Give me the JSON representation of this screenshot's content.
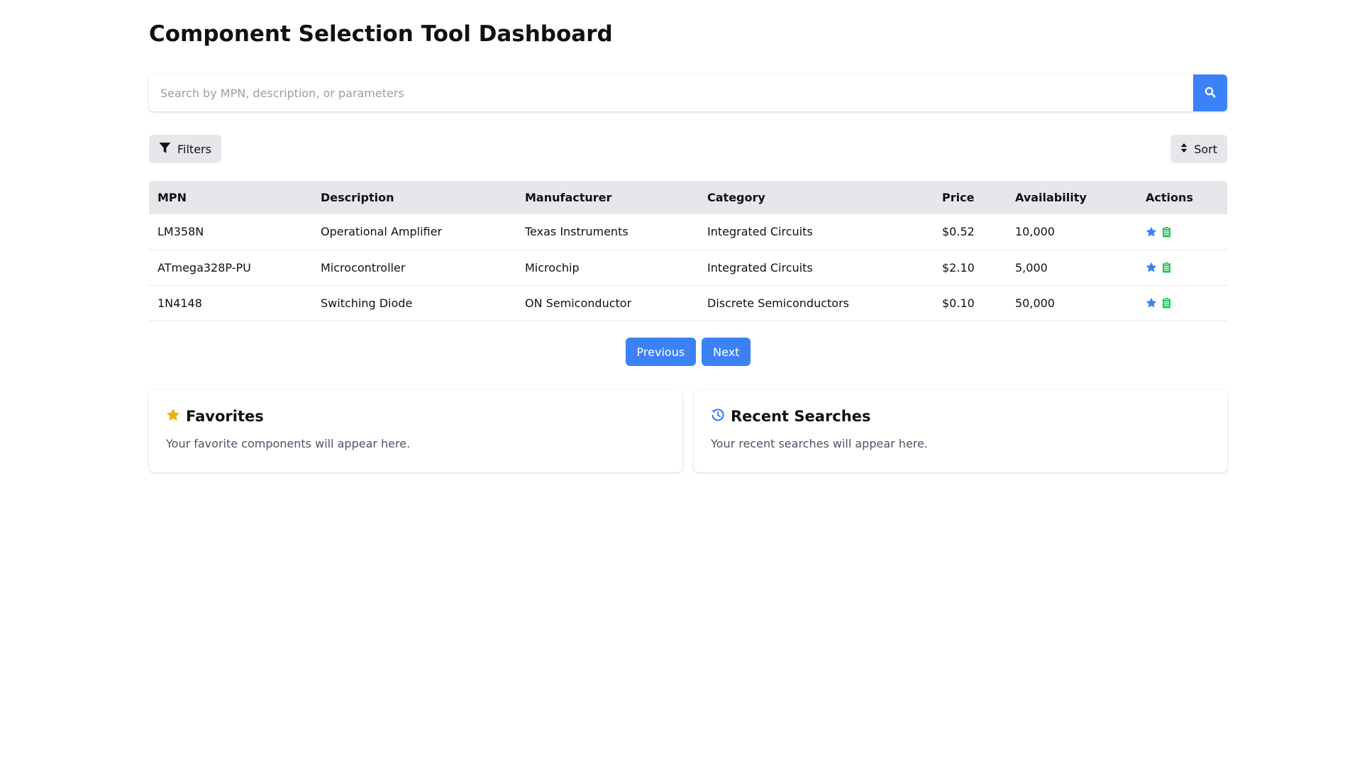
{
  "page": {
    "title": "Component Selection Tool Dashboard"
  },
  "search": {
    "placeholder": "Search by MPN, description, or parameters",
    "value": "",
    "button_icon": "search-icon"
  },
  "toolbar": {
    "filters_label": "Filters",
    "filters_icon": "filter-icon",
    "sort_label": "Sort",
    "sort_icon": "sort-icon"
  },
  "table": {
    "headers": [
      "MPN",
      "Description",
      "Manufacturer",
      "Category",
      "Price",
      "Availability",
      "Actions"
    ],
    "rows": [
      {
        "mpn": "LM358N",
        "description": "Operational Amplifier",
        "manufacturer": "Texas Instruments",
        "category": "Integrated Circuits",
        "price": "$0.52",
        "availability": "10,000"
      },
      {
        "mpn": "ATmega328P-PU",
        "description": "Microcontroller",
        "manufacturer": "Microchip",
        "category": "Integrated Circuits",
        "price": "$2.10",
        "availability": "5,000"
      },
      {
        "mpn": "1N4148",
        "description": "Switching Diode",
        "manufacturer": "ON Semiconductor",
        "category": "Discrete Semiconductors",
        "price": "$0.10",
        "availability": "50,000"
      }
    ],
    "action_icons": [
      "star-icon",
      "clipboard-icon"
    ]
  },
  "pagination": {
    "previous_label": "Previous",
    "next_label": "Next"
  },
  "favorites": {
    "title": "Favorites",
    "icon": "star-icon",
    "body": "Your favorite components will appear here."
  },
  "recent": {
    "title": "Recent Searches",
    "icon": "history-icon",
    "body": "Your recent searches will appear here."
  },
  "colors": {
    "accent": "#3b82f6",
    "favorite_star": "#eab308",
    "clipboard": "#22c55e",
    "header_bg": "#e5e7eb"
  }
}
